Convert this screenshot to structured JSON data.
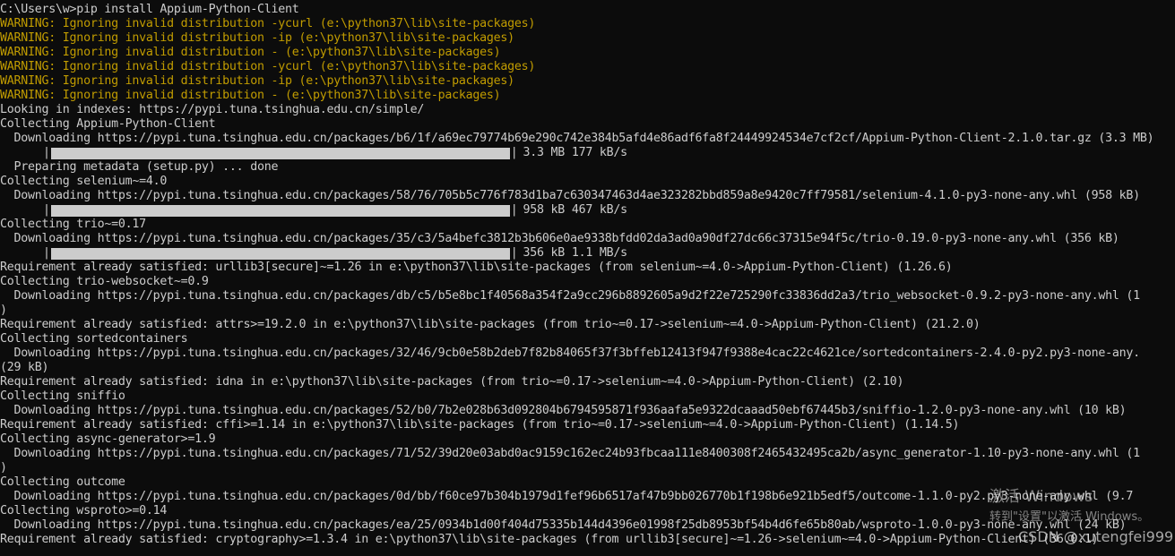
{
  "terminal": {
    "colors": {
      "background": "#0c0c0c",
      "text": "#cccccc",
      "warning": "#c19c00"
    },
    "lines": [
      {
        "type": "text",
        "text": "C:\\Users\\w>pip install Appium-Python-Client"
      },
      {
        "type": "warning",
        "text": "WARNING: Ignoring invalid distribution -ycurl (e:\\python37\\lib\\site-packages)"
      },
      {
        "type": "warning",
        "text": "WARNING: Ignoring invalid distribution -ip (e:\\python37\\lib\\site-packages)"
      },
      {
        "type": "warning",
        "text": "WARNING: Ignoring invalid distribution - (e:\\python37\\lib\\site-packages)"
      },
      {
        "type": "warning",
        "text": "WARNING: Ignoring invalid distribution -ycurl (e:\\python37\\lib\\site-packages)"
      },
      {
        "type": "warning",
        "text": "WARNING: Ignoring invalid distribution -ip (e:\\python37\\lib\\site-packages)"
      },
      {
        "type": "warning",
        "text": "WARNING: Ignoring invalid distribution - (e:\\python37\\lib\\site-packages)"
      },
      {
        "type": "text",
        "text": "Looking in indexes: https://pypi.tuna.tsinghua.edu.cn/simple/"
      },
      {
        "type": "text",
        "text": "Collecting Appium-Python-Client"
      },
      {
        "type": "text",
        "text": "  Downloading https://pypi.tuna.tsinghua.edu.cn/packages/b6/1f/a69ec79774b69e290c742e384b5afd4e86adf6fa8f24449924534e7cf2cf/Appium-Python-Client-2.1.0.tar.gz (3.3 MB)"
      },
      {
        "type": "progress",
        "text": "3.3 MB 177 kB/s"
      },
      {
        "type": "text",
        "text": "  Preparing metadata (setup.py) ... done"
      },
      {
        "type": "text",
        "text": "Collecting selenium~=4.0"
      },
      {
        "type": "text",
        "text": "  Downloading https://pypi.tuna.tsinghua.edu.cn/packages/58/76/705b5c776f783d1ba7c630347463d4ae323282bbd859a8e9420c7ff79581/selenium-4.1.0-py3-none-any.whl (958 kB)"
      },
      {
        "type": "progress",
        "text": "958 kB 467 kB/s"
      },
      {
        "type": "text",
        "text": "Collecting trio~=0.17"
      },
      {
        "type": "text",
        "text": "  Downloading https://pypi.tuna.tsinghua.edu.cn/packages/35/c3/5a4befc3812b3b606e0ae9338bfdd02da3ad0a90df27dc66c37315e94f5c/trio-0.19.0-py3-none-any.whl (356 kB)"
      },
      {
        "type": "progress",
        "text": "356 kB 1.1 MB/s"
      },
      {
        "type": "text",
        "text": "Requirement already satisfied: urllib3[secure]~=1.26 in e:\\python37\\lib\\site-packages (from selenium~=4.0->Appium-Python-Client) (1.26.6)"
      },
      {
        "type": "text",
        "text": "Collecting trio-websocket~=0.9"
      },
      {
        "type": "text",
        "text": "  Downloading https://pypi.tuna.tsinghua.edu.cn/packages/db/c5/b5e8bc1f40568a354f2a9cc296b8892605a9d2f22e725290fc33836dd2a3/trio_websocket-0.9.2-py3-none-any.whl (1"
      },
      {
        "type": "text",
        "text": ")"
      },
      {
        "type": "text",
        "text": "Requirement already satisfied: attrs>=19.2.0 in e:\\python37\\lib\\site-packages (from trio~=0.17->selenium~=4.0->Appium-Python-Client) (21.2.0)"
      },
      {
        "type": "text",
        "text": "Collecting sortedcontainers"
      },
      {
        "type": "text",
        "text": "  Downloading https://pypi.tuna.tsinghua.edu.cn/packages/32/46/9cb0e58b2deb7f82b84065f37f3bffeb12413f947f9388e4cac22c4621ce/sortedcontainers-2.4.0-py2.py3-none-any."
      },
      {
        "type": "text",
        "text": "(29 kB)"
      },
      {
        "type": "text",
        "text": "Requirement already satisfied: idna in e:\\python37\\lib\\site-packages (from trio~=0.17->selenium~=4.0->Appium-Python-Client) (2.10)"
      },
      {
        "type": "text",
        "text": "Collecting sniffio"
      },
      {
        "type": "text",
        "text": "  Downloading https://pypi.tuna.tsinghua.edu.cn/packages/52/b0/7b2e028b63d092804b6794595871f936aafa5e9322dcaaad50ebf67445b3/sniffio-1.2.0-py3-none-any.whl (10 kB)"
      },
      {
        "type": "text",
        "text": "Requirement already satisfied: cffi>=1.14 in e:\\python37\\lib\\site-packages (from trio~=0.17->selenium~=4.0->Appium-Python-Client) (1.14.5)"
      },
      {
        "type": "text",
        "text": "Collecting async-generator>=1.9"
      },
      {
        "type": "text",
        "text": "  Downloading https://pypi.tuna.tsinghua.edu.cn/packages/71/52/39d20e03abd0ac9159c162ec24b93fbcaa111e8400308f2465432495ca2b/async_generator-1.10-py3-none-any.whl (1"
      },
      {
        "type": "text",
        "text": ")"
      },
      {
        "type": "text",
        "text": "Collecting outcome"
      },
      {
        "type": "text",
        "text": "  Downloading https://pypi.tuna.tsinghua.edu.cn/packages/0d/bb/f60ce97b304b1979d1fef96b6517af47b9bb026770b1f198b6e921b5edf5/outcome-1.1.0-py2.py3-none-any.whl (9.7"
      },
      {
        "type": "text",
        "text": "Collecting wsproto>=0.14"
      },
      {
        "type": "text",
        "text": "  Downloading https://pypi.tuna.tsinghua.edu.cn/packages/ea/25/0934b1d00f404d75335b144d4396e01998f25db8953bf54b4d6fe65b80ab/wsproto-1.0.0-py3-none-any.whl (24 kB)"
      },
      {
        "type": "text",
        "text": "Requirement already satisfied: cryptography>=1.3.4 in e:\\python37\\lib\\site-packages (from urllib3[secure]~=1.26->selenium~=4.0->Appium-Python-Client) (36.0.1)"
      }
    ]
  },
  "watermark": {
    "activation_title": "激活 Windows",
    "activation_sub": "转到\"设置\"以激活 Windows。",
    "csdn": "CSDN @xutengfei999"
  }
}
